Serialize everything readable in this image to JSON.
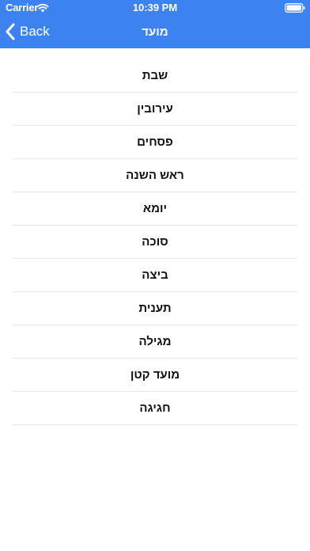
{
  "status_bar": {
    "carrier": "Carrier",
    "time": "10:39 PM",
    "icons": [
      "wifi-icon",
      "battery-icon"
    ]
  },
  "nav": {
    "back_label": "Back",
    "back_icon": "chevron-left-icon",
    "title": "מועד"
  },
  "colors": {
    "header_background": "#3d82f2",
    "header_text": "#ffffff",
    "separator": "#e6e6e6"
  },
  "list": {
    "items": [
      {
        "label": "שבת"
      },
      {
        "label": "עירובין"
      },
      {
        "label": "פסחים"
      },
      {
        "label": "ראש השנה"
      },
      {
        "label": "יומא"
      },
      {
        "label": "סוכה"
      },
      {
        "label": "ביצה"
      },
      {
        "label": "תענית"
      },
      {
        "label": "מגילה"
      },
      {
        "label": "מועד קטן"
      },
      {
        "label": "חגיגה"
      }
    ]
  }
}
